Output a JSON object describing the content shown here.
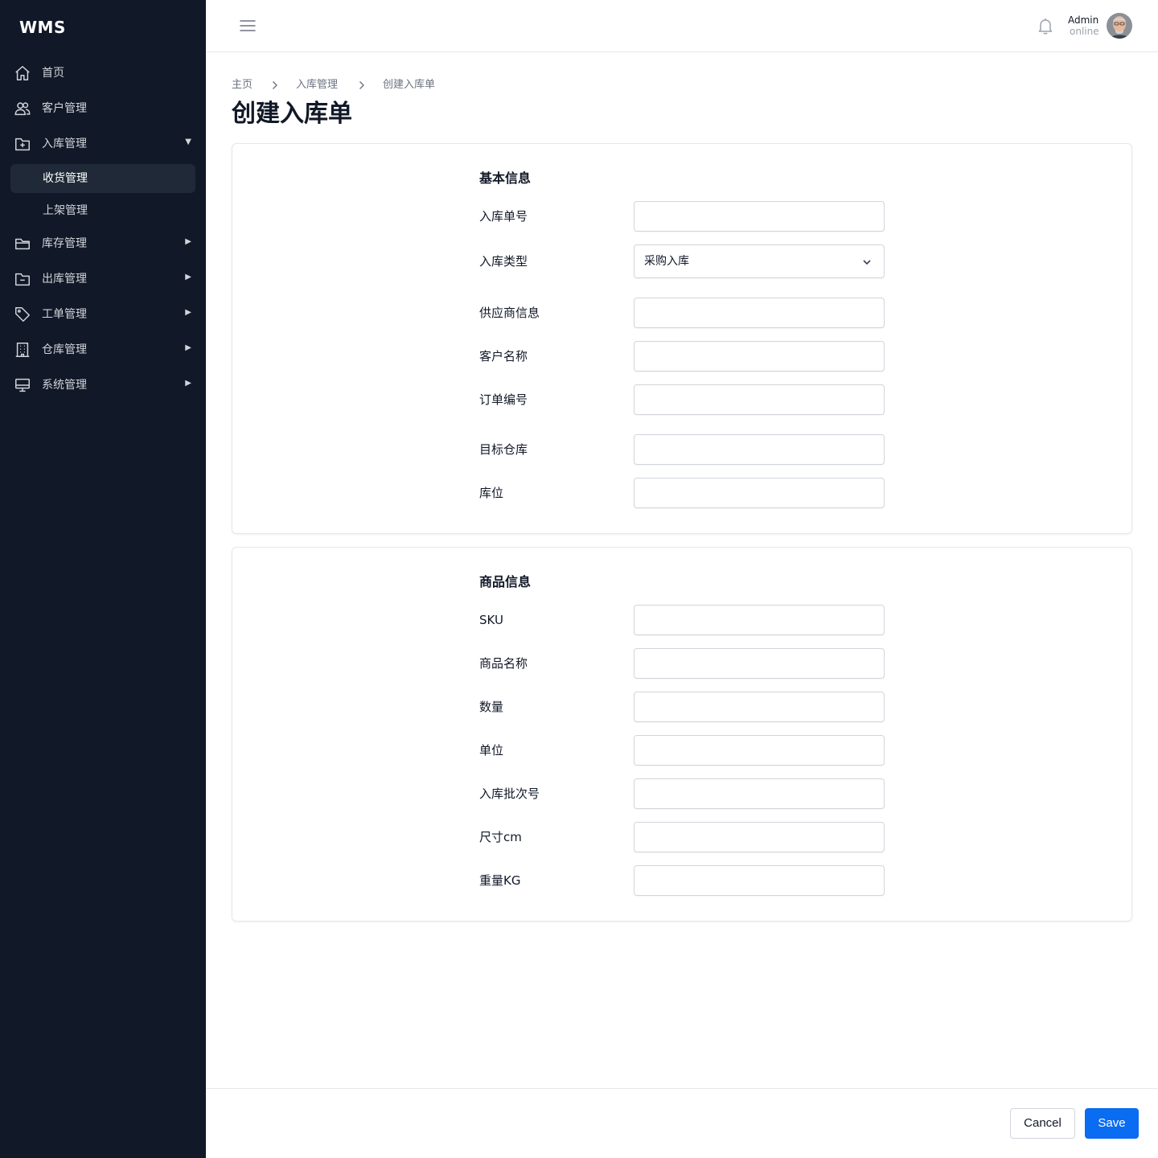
{
  "app": {
    "logo": "WMS"
  },
  "sidebar": {
    "items": [
      {
        "label": "首页",
        "icon": "home-icon"
      },
      {
        "label": "客户管理",
        "icon": "users-icon"
      },
      {
        "label": "入库管理",
        "icon": "inbox-plus-icon",
        "expanded": true,
        "arrow": "▼"
      },
      {
        "label": "库存管理",
        "icon": "folder-icon",
        "arrow": "▶"
      },
      {
        "label": "出库管理",
        "icon": "folder-minus-icon",
        "arrow": "▶"
      },
      {
        "label": "工单管理",
        "icon": "tag-icon",
        "arrow": "▶"
      },
      {
        "label": "仓库管理",
        "icon": "building-icon",
        "arrow": "▶"
      },
      {
        "label": "系统管理",
        "icon": "monitor-icon",
        "arrow": "▶"
      }
    ],
    "subitems": [
      {
        "label": "收货管理",
        "active": true
      },
      {
        "label": "上架管理",
        "active": false
      }
    ]
  },
  "header": {
    "user_name": "Admin",
    "user_status": "online"
  },
  "breadcrumb": [
    "主页",
    "入库管理",
    "创建入库单"
  ],
  "page_title": "创建入库单",
  "basic_info": {
    "title": "基本信息",
    "fields": [
      {
        "label": "入库单号",
        "value": ""
      },
      {
        "label": "入库类型",
        "value": "采购入库"
      },
      {
        "label": "供应商信息",
        "value": ""
      },
      {
        "label": "客户名称",
        "value": ""
      },
      {
        "label": "订单编号",
        "value": ""
      },
      {
        "label": "目标仓库",
        "value": ""
      },
      {
        "label": "库位",
        "value": ""
      }
    ]
  },
  "product_info": {
    "title": "商品信息",
    "fields": [
      {
        "label": "SKU",
        "value": ""
      },
      {
        "label": "商品名称",
        "value": ""
      },
      {
        "label": "数量",
        "value": ""
      },
      {
        "label": "单位",
        "value": ""
      },
      {
        "label": "入库批次号",
        "value": ""
      },
      {
        "label": "尺寸cm",
        "value": ""
      },
      {
        "label": "重量KG",
        "value": ""
      }
    ]
  },
  "footer": {
    "cancel_label": "Cancel",
    "save_label": "Save"
  },
  "colors": {
    "sidebar_bg": "#111827",
    "primary": "#0a6cf0",
    "border": "#e5e7eb"
  }
}
